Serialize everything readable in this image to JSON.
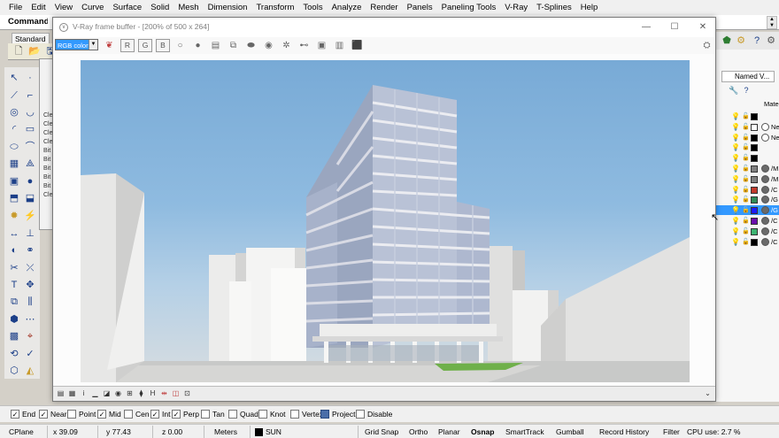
{
  "menu": [
    "File",
    "Edit",
    "View",
    "Curve",
    "Surface",
    "Solid",
    "Mesh",
    "Dimension",
    "Transform",
    "Tools",
    "Analyze",
    "Render",
    "Panels",
    "Paneling Tools",
    "V-Ray",
    "T-Splines",
    "Help"
  ],
  "command": {
    "label": "Command:",
    "value": ""
  },
  "toolbar_tab": "Standard",
  "behind_panel_rows": [
    "Cle",
    "Cle",
    "Cle",
    "Cle",
    "Bit",
    "Bit",
    "Bit",
    "Bit",
    "Bit",
    "Cle"
  ],
  "vray": {
    "title": "V-Ray frame buffer - [200% of 500 x 264]",
    "channel": "RGB color",
    "channel_buttons": [
      "R",
      "G",
      "B"
    ],
    "window_buttons": {
      "minimize": "—",
      "maximize": "☐",
      "close": "✕"
    }
  },
  "right_panel": {
    "tab": "Named V...",
    "column_header": "Mater",
    "layers": [
      {
        "swatch": "#000000",
        "material": "",
        "name": "",
        "selected": false
      },
      {
        "swatch": "#ffffff",
        "material": "#ffffff",
        "name": "Ne",
        "selected": false
      },
      {
        "swatch": "#000000",
        "material": "#ffffff",
        "name": "Ne",
        "selected": false
      },
      {
        "swatch": "#000000",
        "material": "",
        "name": "",
        "selected": false
      },
      {
        "swatch": "#000000",
        "material": "",
        "name": "",
        "selected": false
      },
      {
        "swatch": "#7f7f7f",
        "material": "#6a6a6a",
        "name": "/M",
        "selected": false
      },
      {
        "swatch": "#7f7f7f",
        "material": "#6a6a6a",
        "name": "/M",
        "selected": false
      },
      {
        "swatch": "#c0392b",
        "material": "#6a6a6a",
        "name": "/C",
        "selected": false
      },
      {
        "swatch": "#2e8b57",
        "material": "#6a6a6a",
        "name": "/G",
        "selected": false
      },
      {
        "swatch": "#1a1aff",
        "material": "#6a6a6a",
        "name": "/G",
        "selected": true
      },
      {
        "swatch": "#6a0dad",
        "material": "#6a6a6a",
        "name": "/C",
        "selected": false
      },
      {
        "swatch": "#3cb371",
        "material": "#6a6a6a",
        "name": "/C",
        "selected": false
      },
      {
        "swatch": "#000000",
        "material": "#6a6a6a",
        "name": "/C",
        "selected": false
      }
    ]
  },
  "osnaps": [
    {
      "label": "End",
      "checked": true
    },
    {
      "label": "Near",
      "checked": true
    },
    {
      "label": "Point",
      "checked": false
    },
    {
      "label": "Mid",
      "checked": true
    },
    {
      "label": "Cen",
      "checked": false
    },
    {
      "label": "Int",
      "checked": true
    },
    {
      "label": "Perp",
      "checked": true
    },
    {
      "label": "Tan",
      "checked": false
    },
    {
      "label": "Quad",
      "checked": false
    },
    {
      "label": "Knot",
      "checked": false
    },
    {
      "label": "Vertex",
      "checked": false
    },
    {
      "label": "Project",
      "checked": false,
      "active": true
    },
    {
      "label": "Disable",
      "checked": false
    }
  ],
  "status": {
    "cplane": "CPlane",
    "x": "x 39.09",
    "y": "y 77.43",
    "z": "z 0.00",
    "units": "Meters",
    "layer": "SUN",
    "grid_snap": "Grid Snap",
    "ortho": "Ortho",
    "planar": "Planar",
    "osnap": "Osnap",
    "smarttrack": "SmartTrack",
    "gumball": "Gumball",
    "record_history": "Record History",
    "filter": "Filter",
    "cpu": "CPU use: 2.7 %"
  }
}
